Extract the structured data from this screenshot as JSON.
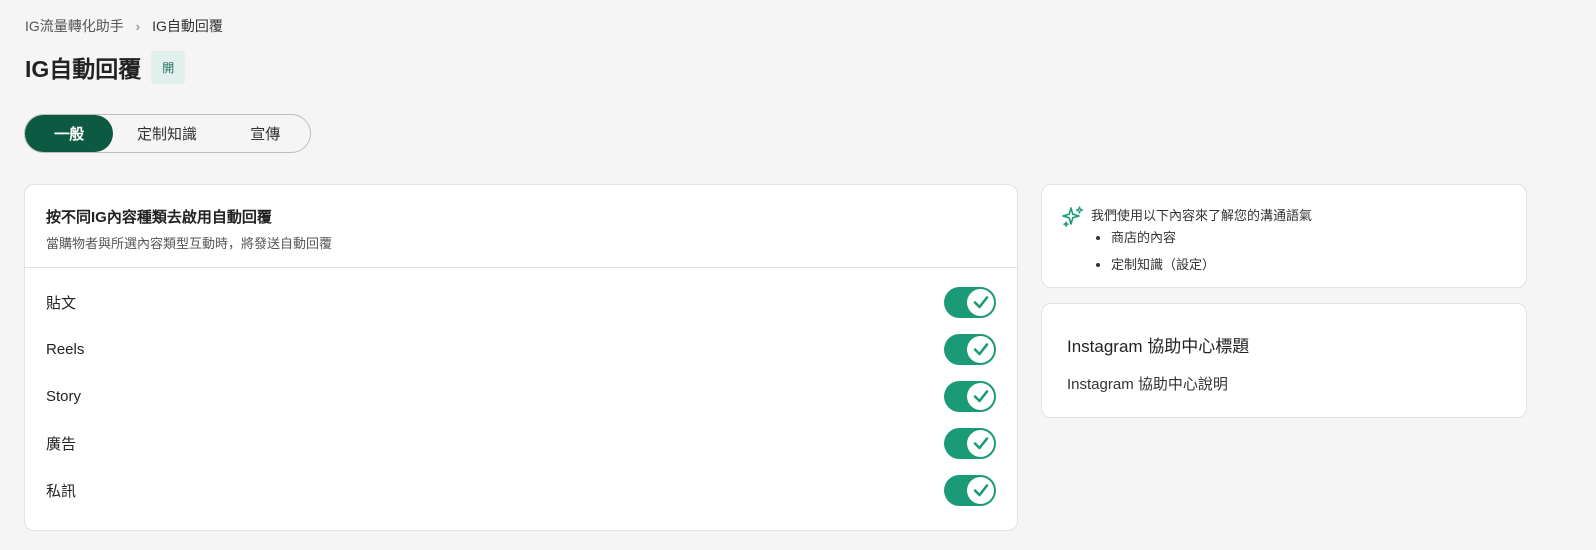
{
  "breadcrumb": {
    "parent": "IG流量轉化助手",
    "separator": "›",
    "current": "IG自動回覆"
  },
  "header": {
    "title": "IG自動回覆",
    "status": "開"
  },
  "tabs": [
    {
      "label": "一般",
      "active": true
    },
    {
      "label": "定制知識",
      "active": false
    },
    {
      "label": "宣傳",
      "active": false
    }
  ],
  "main_card": {
    "title": "按不同IG內容種類去啟用自動回覆",
    "subtitle": "當購物者與所選內容類型互動時，將發送自動回覆",
    "toggles": [
      {
        "label": "貼文",
        "enabled": true
      },
      {
        "label": "Reels",
        "enabled": true
      },
      {
        "label": "Story",
        "enabled": true
      },
      {
        "label": "廣告",
        "enabled": true
      },
      {
        "label": "私訊",
        "enabled": true
      }
    ]
  },
  "info_card": {
    "icon": "sparkle-icon",
    "intro": "我們使用以下內容來了解您的溝通語氣",
    "items": [
      "商店的內容",
      "定制知識（設定）"
    ]
  },
  "help_card": {
    "title": "Instagram 協助中心標題",
    "description": "Instagram 協助中心說明"
  },
  "colors": {
    "accent": "#0d5a43",
    "toggle_on": "#1b9a78",
    "badge_bg": "#e1f0ec"
  }
}
